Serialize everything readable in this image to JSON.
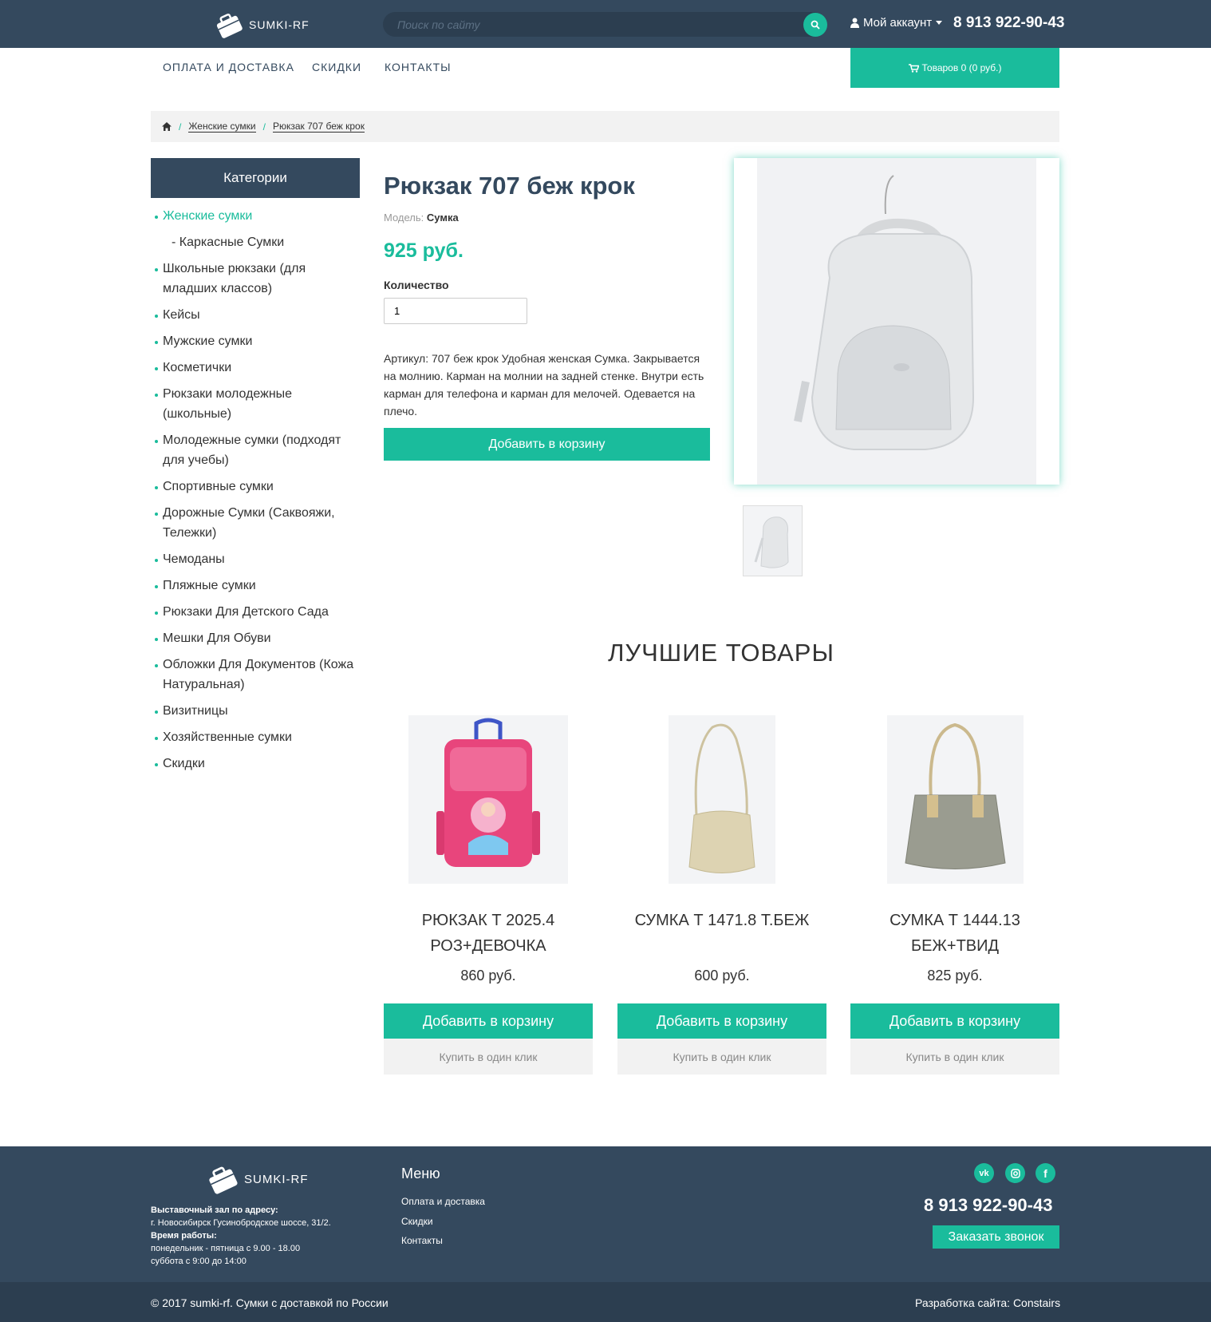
{
  "header": {
    "logo_text": "SUMKI-RF",
    "search_placeholder": "Поиск по сайту",
    "account_label": "Мой аккаунт",
    "phone": "8 913 922-90-43"
  },
  "nav": {
    "items": [
      {
        "label": "ОПЛАТА И ДОСТАВКА"
      },
      {
        "label": "СКИДКИ"
      },
      {
        "label": "КОНТАКТЫ"
      }
    ],
    "cart_label": "Товаров 0 (0 руб.)"
  },
  "breadcrumb": {
    "items": [
      "Женские сумки",
      "Рюкзак 707 беж крок"
    ]
  },
  "sidebar": {
    "title": "Категории",
    "items": [
      {
        "label": "Женские сумки",
        "active": true
      },
      {
        "label": "- Каркасные Сумки",
        "sub": true
      },
      {
        "label": "Школьные рюкзаки (для младших классов)"
      },
      {
        "label": "Кейсы"
      },
      {
        "label": "Мужские сумки"
      },
      {
        "label": "Косметички"
      },
      {
        "label": "Рюкзаки молодежные (школьные)"
      },
      {
        "label": "Молодежные сумки (подходят для учебы)"
      },
      {
        "label": "Спортивные сумки"
      },
      {
        "label": "Дорожные Сумки (Саквояжи, Тележки)"
      },
      {
        "label": "Чемоданы"
      },
      {
        "label": "Пляжные сумки"
      },
      {
        "label": "Рюкзаки Для Детского Сада"
      },
      {
        "label": "Мешки Для Обуви"
      },
      {
        "label": "Обложки Для Документов (Кожа Натуральная)"
      },
      {
        "label": "Визитницы"
      },
      {
        "label": "Хозяйственные сумки"
      },
      {
        "label": "Скидки"
      }
    ]
  },
  "product": {
    "title": "Рюкзак 707 беж крок",
    "model_label": "Модель:",
    "model_value": "Сумка",
    "price": "925 руб.",
    "qty_label": "Количество",
    "qty_value": "1",
    "description": "Артикул: 707 беж крок Удобная женская Сумка. Закрывается на молнию. Карман на молнии на задней стенке. Внутри есть карман для телефона и карман для мелочей. Одевается на плечо.",
    "add_label": "Добавить в корзину"
  },
  "best": {
    "title": "ЛУЧШИЕ ТОВАРЫ",
    "items": [
      {
        "name": "РЮКЗАК Т 2025.4 РОЗ+ДЕВОЧКА",
        "price": "860 руб.",
        "add_label": "Добавить в корзину",
        "one_click_label": "Купить в один клик"
      },
      {
        "name": "СУМКА Т 1471.8 Т.БЕЖ",
        "price": "600 руб.",
        "add_label": "Добавить в корзину",
        "one_click_label": "Купить в один клик"
      },
      {
        "name": "СУМКА Т 1444.13 БЕЖ+ТВИД",
        "price": "825 руб.",
        "add_label": "Добавить в корзину",
        "one_click_label": "Купить в один клик"
      }
    ]
  },
  "footer": {
    "logo_text": "SUMKI-RF",
    "address_title": "Выставочный зал по адресу:",
    "address": "г. Новосибирск Гусинобродское шоссе, 31/2.",
    "hours_title": "Время работы:",
    "hours_weekday": "понедельник - пятница с 9.00 - 18.00",
    "hours_saturday": "суббота с 9:00 до 14:00",
    "menu_title": "Меню",
    "menu_items": [
      "Оплата и доставка",
      "Скидки",
      "Контакты"
    ],
    "phone": "8 913 922-90-43",
    "callback_label": "Заказать звонок",
    "copyright": "© 2017 sumki-rf. Сумки с доставкой по России",
    "developer": "Разработка сайта: Constairs"
  },
  "colors": {
    "accent": "#1abc9c",
    "dark": "#34495e",
    "darker": "#2c3e50"
  }
}
